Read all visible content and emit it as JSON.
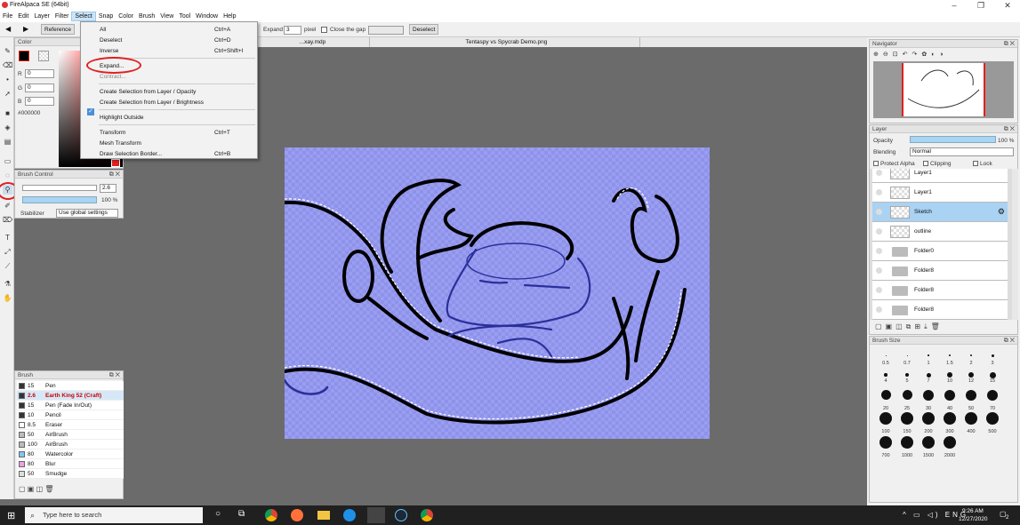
{
  "app": {
    "title": "FireAlpaca SE (64bit)"
  },
  "menu": [
    "File",
    "Edit",
    "Layer",
    "Filter",
    "Select",
    "Snap",
    "Color",
    "Brush",
    "View",
    "Tool",
    "Window",
    "Help"
  ],
  "toolbar": {
    "reference": "Reference",
    "expand_label": "Expand",
    "expand_value": "3",
    "pixel": "pixel",
    "close_gap": "Close the gap",
    "deselect": "Deselect"
  },
  "tabs": [
    "...xay.mdp",
    "Tentaspy vs Spycrab Demo.png"
  ],
  "select_menu": [
    {
      "label": "All",
      "shortcut": "Ctrl+A"
    },
    {
      "label": "Deselect",
      "shortcut": "Ctrl+D"
    },
    {
      "label": "Inverse",
      "shortcut": "Ctrl+Shift+I"
    },
    {
      "label": "Expand...",
      "shortcut": ""
    },
    {
      "label": "Contract...",
      "shortcut": ""
    },
    {
      "label": "Create Selection from Layer / Opacity",
      "shortcut": ""
    },
    {
      "label": "Create Selection from Layer / Brightness",
      "shortcut": ""
    },
    {
      "label": "Highlight Outside",
      "shortcut": ""
    },
    {
      "label": "Transform",
      "shortcut": "Ctrl+T"
    },
    {
      "label": "Mesh Transform",
      "shortcut": ""
    },
    {
      "label": "Draw Selection Border...",
      "shortcut": "Ctrl+B"
    }
  ],
  "color_panel": {
    "title": "Color",
    "r_label": "R",
    "g_label": "G",
    "b_label": "B",
    "r": "0",
    "g": "0",
    "b": "0",
    "hex": "#000000",
    "primary": "#000000",
    "accent": "#e02020"
  },
  "brush_control": {
    "title": "Brush Control",
    "size": "2.6",
    "opacity": "100 %",
    "stabilizer_label": "Stabilizer",
    "stabilizer_value": "Use global settings"
  },
  "brush_panel": {
    "title": "Brush",
    "items": [
      {
        "size": "15",
        "name": "Pen",
        "color": "#333333"
      },
      {
        "size": "2.6",
        "name": "Earth King 52 (Craft)",
        "color": "#333333"
      },
      {
        "size": "15",
        "name": "Pen (Fade In/Out)",
        "color": "#333333"
      },
      {
        "size": "10",
        "name": "Pencil",
        "color": "#333333"
      },
      {
        "size": "8.5",
        "name": "Eraser",
        "color": "#ffffff"
      },
      {
        "size": "50",
        "name": "AirBrush",
        "color": "#bbbbbb"
      },
      {
        "size": "100",
        "name": "AirBrush",
        "color": "#bbbbbb"
      },
      {
        "size": "80",
        "name": "Watercolor",
        "color": "#7ec8f0"
      },
      {
        "size": "80",
        "name": "Blur",
        "color": "#f0a0e0"
      },
      {
        "size": "50",
        "name": "Smudge",
        "color": "#dddddd"
      }
    ]
  },
  "navigator": {
    "title": "Navigator"
  },
  "layer_panel": {
    "title": "Layer",
    "opacity_label": "Opacity",
    "opacity_value": "100 %",
    "opacity": 1.0,
    "blending_label": "Blending",
    "blending_value": "Normal",
    "protect_alpha": "Protect Alpha",
    "clipping": "Clipping",
    "lock": "Lock",
    "layers": [
      "Layer1",
      "Layer1",
      "Sketch",
      "outline",
      "Folder0",
      "Folder8",
      "Folder8",
      "Folder8"
    ]
  },
  "brush_size": {
    "title": "Brush Size",
    "row1": [
      "0.5",
      "0.7",
      "1",
      "1.5",
      "2",
      "3"
    ],
    "row2": [
      "4",
      "5",
      "7",
      "10",
      "12",
      "15"
    ],
    "row3": [
      "20",
      "25",
      "30",
      "40",
      "50",
      "70"
    ],
    "row4": [
      "100",
      "150",
      "200",
      "300",
      "400",
      "500"
    ],
    "row5": [
      "700",
      "1000",
      "1500",
      "2000"
    ]
  },
  "taskbar": {
    "search": "Type here to search",
    "time": "9:26 AM",
    "date": "12/27/2020",
    "notif": "2"
  }
}
